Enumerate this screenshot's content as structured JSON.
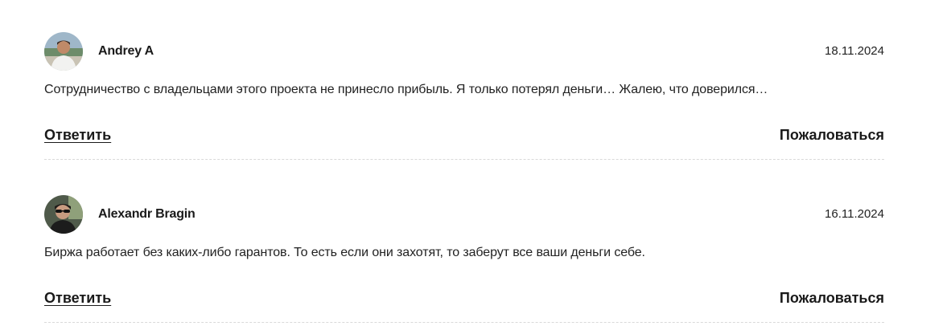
{
  "comments": [
    {
      "author": "Andrey A",
      "date": "18.11.2024",
      "text": "Сотрудничество с владельцами этого проекта не принесло прибыль. Я только потерял деньги… Жалею, что доверился…",
      "reply_label": "Ответить",
      "report_label": "Пожаловаться"
    },
    {
      "author": "Alexandr Bragin",
      "date": "16.11.2024",
      "text": "Биржа работает без каких-либо гарантов. То есть если они захотят, то заберут все ваши деньги себе.",
      "reply_label": "Ответить",
      "report_label": "Пожаловаться"
    }
  ]
}
